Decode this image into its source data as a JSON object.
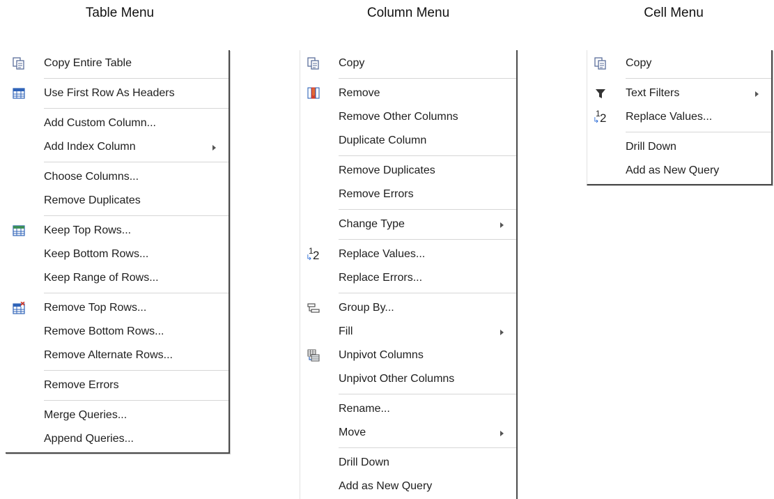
{
  "titles": {
    "table": "Table Menu",
    "column": "Column Menu",
    "cell": "Cell Menu"
  },
  "table_menu": {
    "items": [
      {
        "label": "Copy Entire Table",
        "icon": "copy-icon"
      },
      {
        "label": "Use First Row As Headers",
        "icon": "table-header-icon"
      },
      {
        "label": "Add Custom Column..."
      },
      {
        "label": "Add Index Column",
        "submenu": true
      },
      {
        "label": "Choose Columns..."
      },
      {
        "label": "Remove Duplicates"
      },
      {
        "label": "Keep Top Rows...",
        "icon": "table-keep-icon"
      },
      {
        "label": "Keep Bottom Rows..."
      },
      {
        "label": "Keep Range of Rows..."
      },
      {
        "label": "Remove Top Rows...",
        "icon": "table-remove-icon"
      },
      {
        "label": "Remove Bottom Rows..."
      },
      {
        "label": "Remove Alternate Rows..."
      },
      {
        "label": "Remove Errors"
      },
      {
        "label": "Merge Queries..."
      },
      {
        "label": "Append Queries..."
      }
    ]
  },
  "column_menu": {
    "items": [
      {
        "label": "Copy",
        "icon": "copy-icon"
      },
      {
        "label": "Remove",
        "icon": "remove-column-icon"
      },
      {
        "label": "Remove Other Columns"
      },
      {
        "label": "Duplicate Column"
      },
      {
        "label": "Remove Duplicates"
      },
      {
        "label": "Remove Errors"
      },
      {
        "label": "Change Type",
        "submenu": true
      },
      {
        "label": "Replace Values...",
        "icon": "replace-values-icon"
      },
      {
        "label": "Replace Errors..."
      },
      {
        "label": "Group By...",
        "icon": "group-by-icon"
      },
      {
        "label": "Fill",
        "submenu": true
      },
      {
        "label": "Unpivot Columns",
        "icon": "unpivot-icon"
      },
      {
        "label": "Unpivot Other Columns"
      },
      {
        "label": "Rename..."
      },
      {
        "label": "Move",
        "submenu": true
      },
      {
        "label": "Drill Down"
      },
      {
        "label": "Add as New Query"
      }
    ]
  },
  "cell_menu": {
    "items": [
      {
        "label": "Copy",
        "icon": "copy-icon"
      },
      {
        "label": "Text Filters",
        "icon": "filter-icon",
        "submenu": true
      },
      {
        "label": "Replace Values...",
        "icon": "replace-values-icon"
      },
      {
        "label": "Drill Down"
      },
      {
        "label": "Add as New Query"
      }
    ]
  },
  "colors": {
    "accent_blue": "#2f63b8",
    "accent_green": "#3c8f5a",
    "remove_red": "#d23a2a",
    "border": "#4a4a4a"
  }
}
